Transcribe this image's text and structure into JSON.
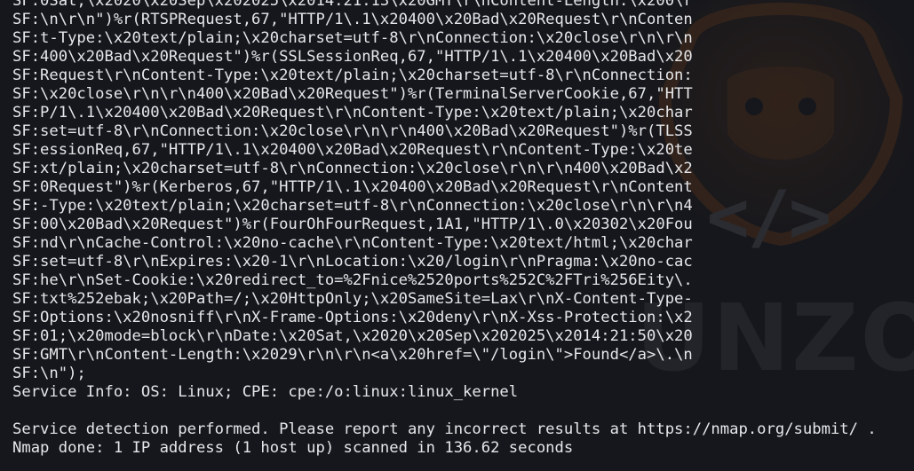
{
  "watermark": {
    "code_glyph": "</>",
    "brand_text": "UNZO"
  },
  "terminal": {
    "lines": [
      "SF:0Sat,\\x2020\\x20Sep\\x202025\\x2014:21:13\\x20GMT\\r\\nContent-Length:\\x200\\r",
      "SF:\\n\\r\\n\")%r(RTSPRequest,67,\"HTTP/1\\.1\\x20400\\x20Bad\\x20Request\\r\\nConten",
      "SF:t-Type:\\x20text/plain;\\x20charset=utf-8\\r\\nConnection:\\x20close\\r\\n\\r\\n",
      "SF:400\\x20Bad\\x20Request\")%r(SSLSessionReq,67,\"HTTP/1\\.1\\x20400\\x20Bad\\x20",
      "SF:Request\\r\\nContent-Type:\\x20text/plain;\\x20charset=utf-8\\r\\nConnection:",
      "SF:\\x20close\\r\\n\\r\\n400\\x20Bad\\x20Request\")%r(TerminalServerCookie,67,\"HTT",
      "SF:P/1\\.1\\x20400\\x20Bad\\x20Request\\r\\nContent-Type:\\x20text/plain;\\x20char",
      "SF:set=utf-8\\r\\nConnection:\\x20close\\r\\n\\r\\n400\\x20Bad\\x20Request\")%r(TLSS",
      "SF:essionReq,67,\"HTTP/1\\.1\\x20400\\x20Bad\\x20Request\\r\\nContent-Type:\\x20te",
      "SF:xt/plain;\\x20charset=utf-8\\r\\nConnection:\\x20close\\r\\n\\r\\n400\\x20Bad\\x2",
      "SF:0Request\")%r(Kerberos,67,\"HTTP/1\\.1\\x20400\\x20Bad\\x20Request\\r\\nContent",
      "SF:-Type:\\x20text/plain;\\x20charset=utf-8\\r\\nConnection:\\x20close\\r\\n\\r\\n4",
      "SF:00\\x20Bad\\x20Request\")%r(FourOhFourRequest,1A1,\"HTTP/1\\.0\\x20302\\x20Fou",
      "SF:nd\\r\\nCache-Control:\\x20no-cache\\r\\nContent-Type:\\x20text/html;\\x20char",
      "SF:set=utf-8\\r\\nExpires:\\x20-1\\r\\nLocation:\\x20/login\\r\\nPragma:\\x20no-cac",
      "SF:he\\r\\nSet-Cookie:\\x20redirect_to=%2Fnice%2520ports%252C%2FTri%256Eity\\.",
      "SF:txt%252ebak;\\x20Path=/;\\x20HttpOnly;\\x20SameSite=Lax\\r\\nX-Content-Type-",
      "SF:Options:\\x20nosniff\\r\\nX-Frame-Options:\\x20deny\\r\\nX-Xss-Protection:\\x2",
      "SF:01;\\x20mode=block\\r\\nDate:\\x20Sat,\\x2020\\x20Sep\\x202025\\x2014:21:50\\x20",
      "SF:GMT\\r\\nContent-Length:\\x2029\\r\\n\\r\\n<a\\x20href=\\\"/login\\\">Found</a>\\.\\n",
      "SF:\\n\");",
      "Service Info: OS: Linux; CPE: cpe:/o:linux:linux_kernel",
      "",
      "Service detection performed. Please report any incorrect results at https://nmap.org/submit/ .",
      "Nmap done: 1 IP address (1 host up) scanned in 136.62 seconds"
    ]
  }
}
